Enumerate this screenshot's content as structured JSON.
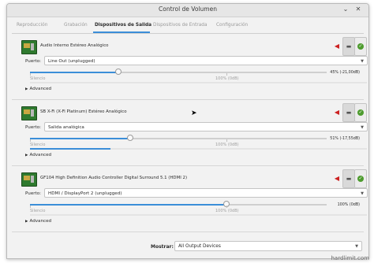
{
  "window": {
    "title": "Control de Volumen"
  },
  "tabs": [
    {
      "label": "Reproducción"
    },
    {
      "label": "Grabación"
    },
    {
      "label": "Dispositivos de Salida"
    },
    {
      "label": "Dispositivos de Entrada"
    },
    {
      "label": "Configuración"
    }
  ],
  "labels": {
    "port": "Puerto:",
    "silence": "Silencio",
    "hundred": "100% (0dB)",
    "advanced": "Advanced",
    "show": "Mostrar:"
  },
  "devices": [
    {
      "name": "Audio Interno Estéreo Analógico",
      "port": "Line Out (unplugged)",
      "volume_readout": "45% (-21,00dB)",
      "volume_fraction": 0.45,
      "peak_fraction": 0.0
    },
    {
      "name": "SB X-Fi (X-Fi Platinum) Estéreo Analógico",
      "port": "Salida analógica",
      "volume_readout": "51% (-17,55dB)",
      "volume_fraction": 0.51,
      "peak_fraction": 0.24
    },
    {
      "name": "GF104 High Definition Audio Controller Digital Surround 5.1 (HDMI 2)",
      "port": "HDMI / DisplayPort 2 (unplugged)",
      "volume_readout": "100% (0dB)",
      "volume_fraction": 1.0,
      "peak_fraction": 0.0
    }
  ],
  "footer": {
    "show_value": "All Output Devices"
  },
  "watermark": "hardlimit.com",
  "colors": {
    "accent": "#3b8ed8",
    "mute": "#cc2222",
    "default_check": "#4d9b2e"
  }
}
